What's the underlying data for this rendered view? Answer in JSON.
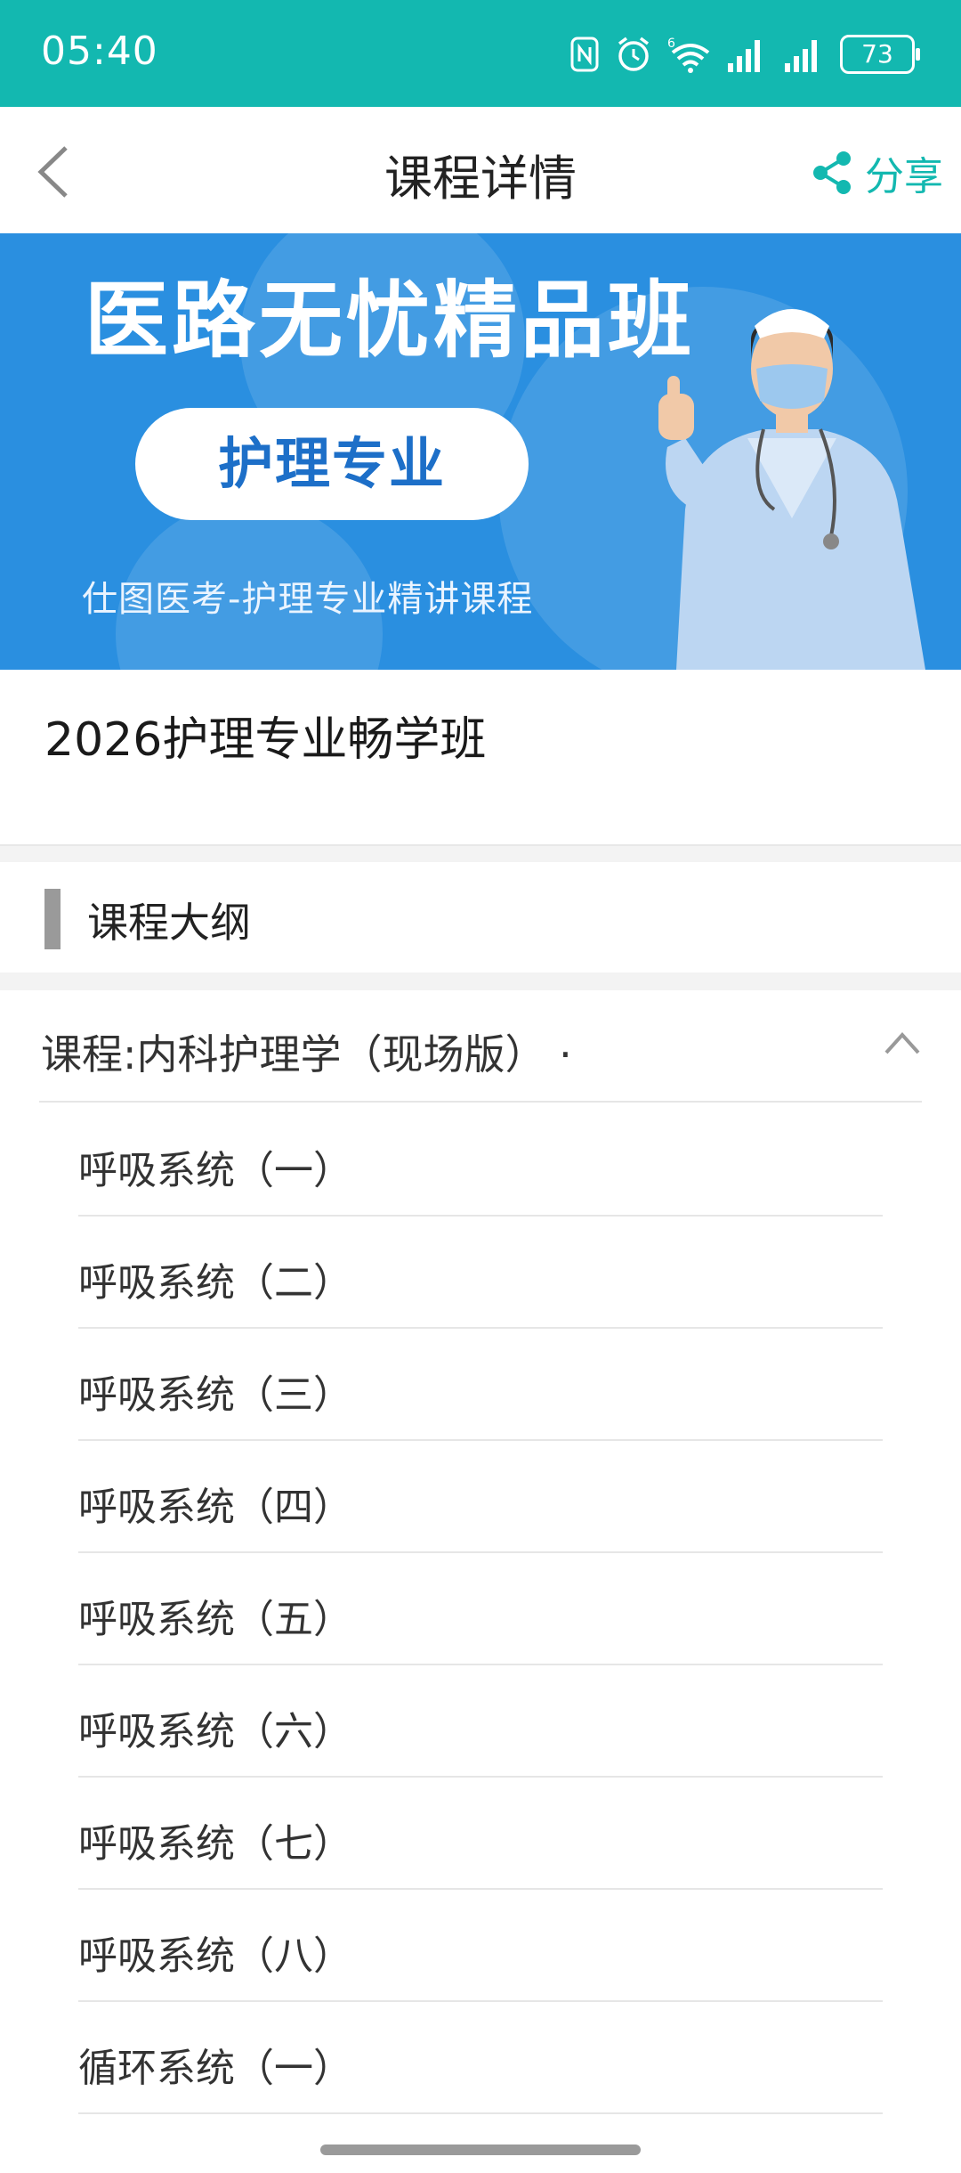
{
  "status_bar": {
    "time": "05:40",
    "battery": "73",
    "icons": [
      "nfc-icon",
      "alarm-icon",
      "wifi-icon",
      "signal-icon",
      "signal-icon",
      "battery-icon"
    ]
  },
  "header": {
    "title": "课程详情",
    "share_label": "分享",
    "back_icon": "chevron-left-icon",
    "share_icon": "share-icon"
  },
  "banner": {
    "headline": "医路无忧精品班",
    "pill": "护理专业",
    "subtitle": "仕图医考-护理专业精讲课程",
    "background": "#2a8fe0"
  },
  "course": {
    "title": "2026护理专业畅学班"
  },
  "outline": {
    "heading": "课程大纲",
    "chapter": {
      "label": "课程:内科护理学（现场版） ·",
      "icon": "chevron-up-icon"
    },
    "lessons": [
      "呼吸系统（一）",
      "呼吸系统（二）",
      "呼吸系统（三）",
      "呼吸系统（四）",
      "呼吸系统（五）",
      "呼吸系统（六）",
      "呼吸系统（七）",
      "呼吸系统（八）",
      "循环系统（一）"
    ]
  },
  "colors": {
    "accent": "#13b8b0",
    "status_bar": "#13b8b0"
  }
}
